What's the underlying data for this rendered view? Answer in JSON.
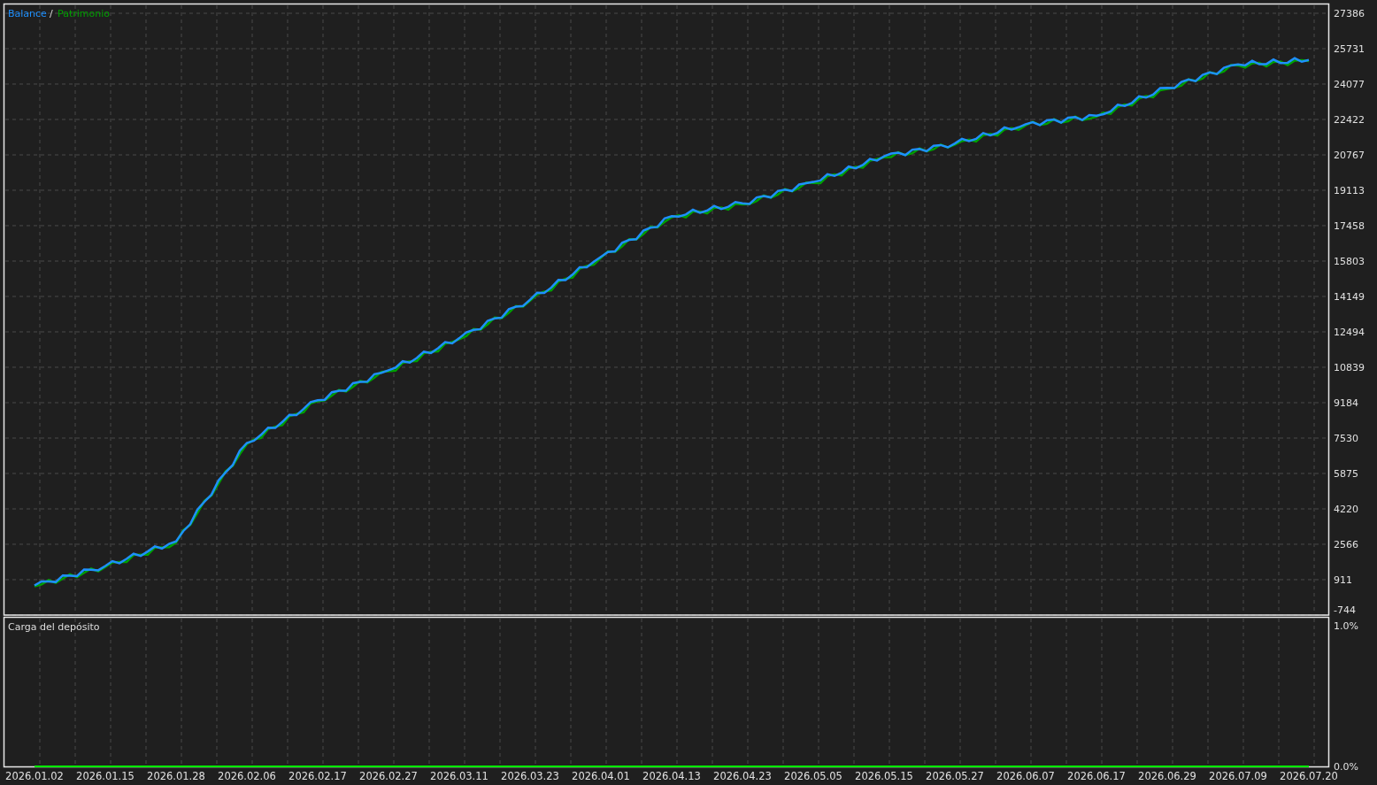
{
  "balance_chart": {
    "legend_separator": "/",
    "chart_data": {
      "type": "line",
      "grid": true,
      "series": [
        {
          "name": "Balance",
          "color": "#1e90ff",
          "values": [
            640,
            1550,
            2700,
            7300,
            9300,
            10700,
            12200,
            14000,
            16000,
            17900,
            18500,
            19500,
            20700,
            21300,
            22200,
            22600,
            23900,
            25000,
            25200
          ]
        },
        {
          "name": "Patrimonio",
          "color": "#00a000",
          "values": [
            600,
            1500,
            2650,
            7250,
            9250,
            10650,
            12150,
            13950,
            15950,
            17850,
            18450,
            19450,
            20650,
            21250,
            22150,
            22550,
            23850,
            24950,
            25150
          ]
        }
      ],
      "ylim": [
        -744,
        27386
      ],
      "yticks": [
        27386,
        25731,
        24077,
        22422,
        20767,
        19113,
        17458,
        15803,
        14149,
        12494,
        10839,
        9184,
        7530,
        5875,
        4220,
        2566,
        911,
        -744
      ]
    }
  },
  "deposit_load_chart": {
    "chart_data": {
      "type": "line",
      "grid": true,
      "categories": [
        "2026.01.02",
        "2026.01.15",
        "2026.01.28",
        "2026.02.06",
        "2026.02.17",
        "2026.02.27",
        "2026.03.11",
        "2026.03.23",
        "2026.04.01",
        "2026.04.13",
        "2026.04.23",
        "2026.05.05",
        "2026.05.15",
        "2026.05.27",
        "2026.06.07",
        "2026.06.17",
        "2026.06.29",
        "2026.07.09",
        "2026.07.20"
      ],
      "series": [
        {
          "name": "Carga del depósito",
          "color": "#00ff00",
          "values": [
            0,
            0,
            0,
            0,
            0,
            0,
            0,
            0,
            0,
            0,
            0,
            0,
            0,
            0,
            0,
            0,
            0,
            0,
            0
          ]
        }
      ],
      "ylim": [
        0,
        1.06
      ],
      "yticks": [
        {
          "value": 1,
          "label": "1.0%"
        },
        {
          "value": 0,
          "label": "0.0%"
        }
      ]
    }
  }
}
